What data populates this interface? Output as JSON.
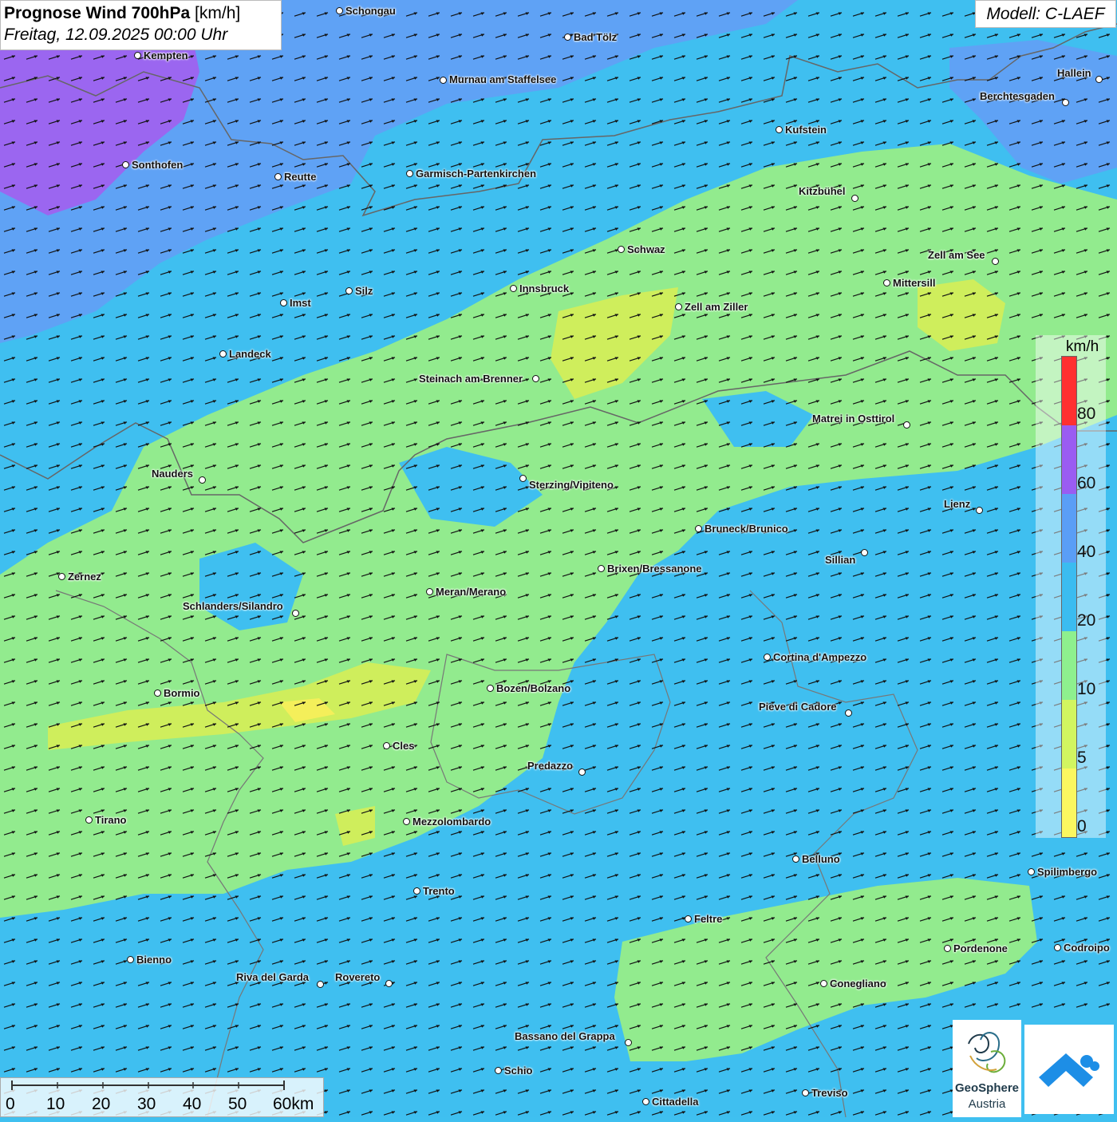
{
  "title": {
    "main": "Prognose Wind 700hPa",
    "unit": "[km/h]",
    "date": "Freitag, 12.09.2025 00:00 Uhr"
  },
  "model": "Modell: C-LAEF",
  "legend": {
    "unit": "km/h",
    "labels": [
      "80",
      "60",
      "40",
      "20",
      "10",
      "5",
      "0"
    ],
    "colors": [
      "#ff3030",
      "#9a5cf2",
      "#5a9ef6",
      "#3bbcf0",
      "#8ef08e",
      "#d2f560",
      "#fbf760"
    ]
  },
  "scale": {
    "labels": [
      "0",
      "10",
      "20",
      "30",
      "40",
      "50",
      "60km"
    ]
  },
  "logos": {
    "geosphere_line1": "GeoSphere",
    "geosphere_line2": "Austria"
  },
  "cities": [
    {
      "name": "Schongau"
    },
    {
      "name": "Bad Tölz"
    },
    {
      "name": "Kempten"
    },
    {
      "name": "Murnau am Staffelsee"
    },
    {
      "name": "Hallein"
    },
    {
      "name": "Berchtesgaden"
    },
    {
      "name": "Kufstein"
    },
    {
      "name": "Sonthofen"
    },
    {
      "name": "Reutte"
    },
    {
      "name": "Garmisch-Partenkirchen"
    },
    {
      "name": "Kitzbühel"
    },
    {
      "name": "Schwaz"
    },
    {
      "name": "Zell am See"
    },
    {
      "name": "Mittersill"
    },
    {
      "name": "Innsbruck"
    },
    {
      "name": "Silz"
    },
    {
      "name": "Imst"
    },
    {
      "name": "Zell am Ziller"
    },
    {
      "name": "Landeck"
    },
    {
      "name": "Steinach am Brenner"
    },
    {
      "name": "Matrei in Osttirol"
    },
    {
      "name": "Nauders"
    },
    {
      "name": "Sterzing/Vipiteno"
    },
    {
      "name": "Lienz"
    },
    {
      "name": "Bruneck/Brunico"
    },
    {
      "name": "Sillian"
    },
    {
      "name": "Brixen/Bressanone"
    },
    {
      "name": "Zernez"
    },
    {
      "name": "Meran/Merano"
    },
    {
      "name": "Schlanders/Silandro"
    },
    {
      "name": "Cortina d'Ampezzo"
    },
    {
      "name": "Bozen/Bolzano"
    },
    {
      "name": "Bormio"
    },
    {
      "name": "Pieve di Cadore"
    },
    {
      "name": "Cles"
    },
    {
      "name": "Predazzo"
    },
    {
      "name": "Tirano"
    },
    {
      "name": "Mezzolombardo"
    },
    {
      "name": "Belluno"
    },
    {
      "name": "Spilimbergo"
    },
    {
      "name": "Trento"
    },
    {
      "name": "Feltre"
    },
    {
      "name": "Pordenone"
    },
    {
      "name": "Codroipo"
    },
    {
      "name": "Bienno"
    },
    {
      "name": "Riva del Garda"
    },
    {
      "name": "Rovereto"
    },
    {
      "name": "Conegliano"
    },
    {
      "name": "Bassano del Grappa"
    },
    {
      "name": "Schio"
    },
    {
      "name": "Treviso"
    },
    {
      "name": "Cittadella"
    }
  ]
}
